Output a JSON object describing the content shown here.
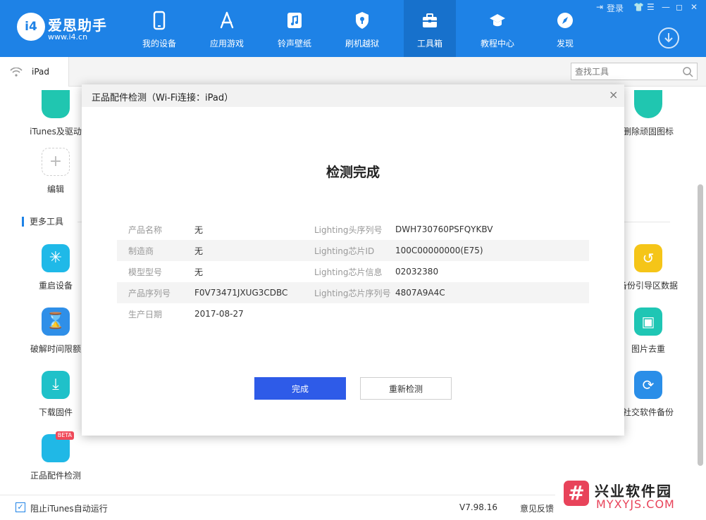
{
  "app": {
    "brand_name": "爱思助手",
    "brand_url": "www.i4.cn",
    "logo_text": "i4"
  },
  "colors": {
    "header_blue": "#1e82e6",
    "primary_button": "#2e5be8",
    "watermark_red": "#e8435a"
  },
  "window": {
    "login_label": "登录"
  },
  "nav": [
    {
      "label": "我的设备",
      "icon": "phone-icon"
    },
    {
      "label": "应用游戏",
      "icon": "app-store-icon"
    },
    {
      "label": "铃声壁纸",
      "icon": "music-icon"
    },
    {
      "label": "刷机越狱",
      "icon": "shield-icon"
    },
    {
      "label": "工具箱",
      "icon": "toolbox-icon",
      "active": true
    },
    {
      "label": "教程中心",
      "icon": "graduation-cap-icon"
    },
    {
      "label": "发现",
      "icon": "compass-icon"
    }
  ],
  "tabbar": {
    "device_tab": "iPad",
    "search_placeholder": "查找工具"
  },
  "tools": {
    "top_left": [
      {
        "label": "iTunes及驱动",
        "icon": "itunes-icon"
      },
      {
        "label": "编辑",
        "icon": "plus-icon"
      }
    ],
    "top_right": [
      {
        "label": "删除顽固图标",
        "icon": "delete-icon"
      }
    ],
    "more_tools_title": "更多工具",
    "left_column": [
      {
        "label": "重启设备",
        "icon": "restart-icon"
      },
      {
        "label": "破解时间限额",
        "icon": "hourglass-icon"
      },
      {
        "label": "下载固件",
        "icon": "download-firmware-icon"
      },
      {
        "label": "正品配件检测",
        "icon": "earphone-icon",
        "badge": "BETA"
      }
    ],
    "right_column": [
      {
        "label": "备份引导区数据",
        "icon": "backup-icon"
      },
      {
        "label": "图片去重",
        "icon": "image-icon"
      },
      {
        "label": "社交软件备份",
        "icon": "social-backup-icon"
      }
    ]
  },
  "modal": {
    "title": "正品配件检测（Wi-Fi连接：iPad）",
    "heading": "检测完成",
    "rows": [
      {
        "k1": "产品名称",
        "v1": "无",
        "k2": "Lighting头序列号",
        "v2": "DWH730760PSFQYKBV"
      },
      {
        "k1": "制造商",
        "v1": "无",
        "k2": "Lighting芯片ID",
        "v2": "100C00000000(E75)"
      },
      {
        "k1": "模型型号",
        "v1": "无",
        "k2": "Lighting芯片信息",
        "v2": "02032380"
      },
      {
        "k1": "产品序列号",
        "v1": "F0V73471JXUG3CDBC",
        "k2": "Lighting芯片序列号",
        "v2": "4807A9A4C"
      },
      {
        "k1": "生产日期",
        "v1": "2017-08-27",
        "k2": "",
        "v2": ""
      }
    ],
    "done_label": "完成",
    "retest_label": "重新检测"
  },
  "footer": {
    "itunes_autorun_label": "阻止iTunes自动运行",
    "version": "V7.98.16",
    "feedback_label": "意见反馈"
  },
  "watermark": {
    "title": "兴业软件园",
    "url": "MYXYJS.COM"
  }
}
